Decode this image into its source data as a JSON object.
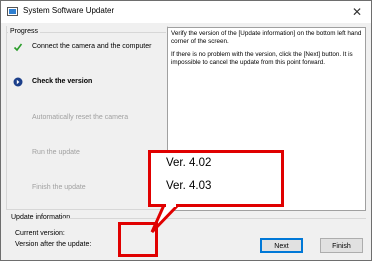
{
  "window": {
    "title": "System Software Updater",
    "close_glyph": "✕"
  },
  "progress": {
    "title": "Progress",
    "steps": [
      {
        "label": "Connect the camera and the computer",
        "state": "done",
        "icon": "check-icon"
      },
      {
        "label": "Check the version",
        "state": "current",
        "icon": "current-step-icon"
      },
      {
        "label": "Automatically reset the camera",
        "state": "pending"
      },
      {
        "label": "Run the update",
        "state": "pending"
      },
      {
        "label": "Finish the update",
        "state": "pending"
      }
    ]
  },
  "info": {
    "paragraph1": "Verify the version of the [Update information] on the bottom left hand corner of the screen.",
    "paragraph2": "If there is no problem with the version, click the [Next] button. It is impossible to cancel the update from this point forward."
  },
  "update_info": {
    "title": "Update information",
    "current_label": "Current version:",
    "current_value": "",
    "after_label": "Version after the update:",
    "after_value": ""
  },
  "buttons": {
    "next_label": "Next",
    "finish_label": "Finish"
  },
  "callout": {
    "line1": "Ver. 4.02",
    "line2": "Ver. 4.03",
    "color": "#e00000"
  }
}
